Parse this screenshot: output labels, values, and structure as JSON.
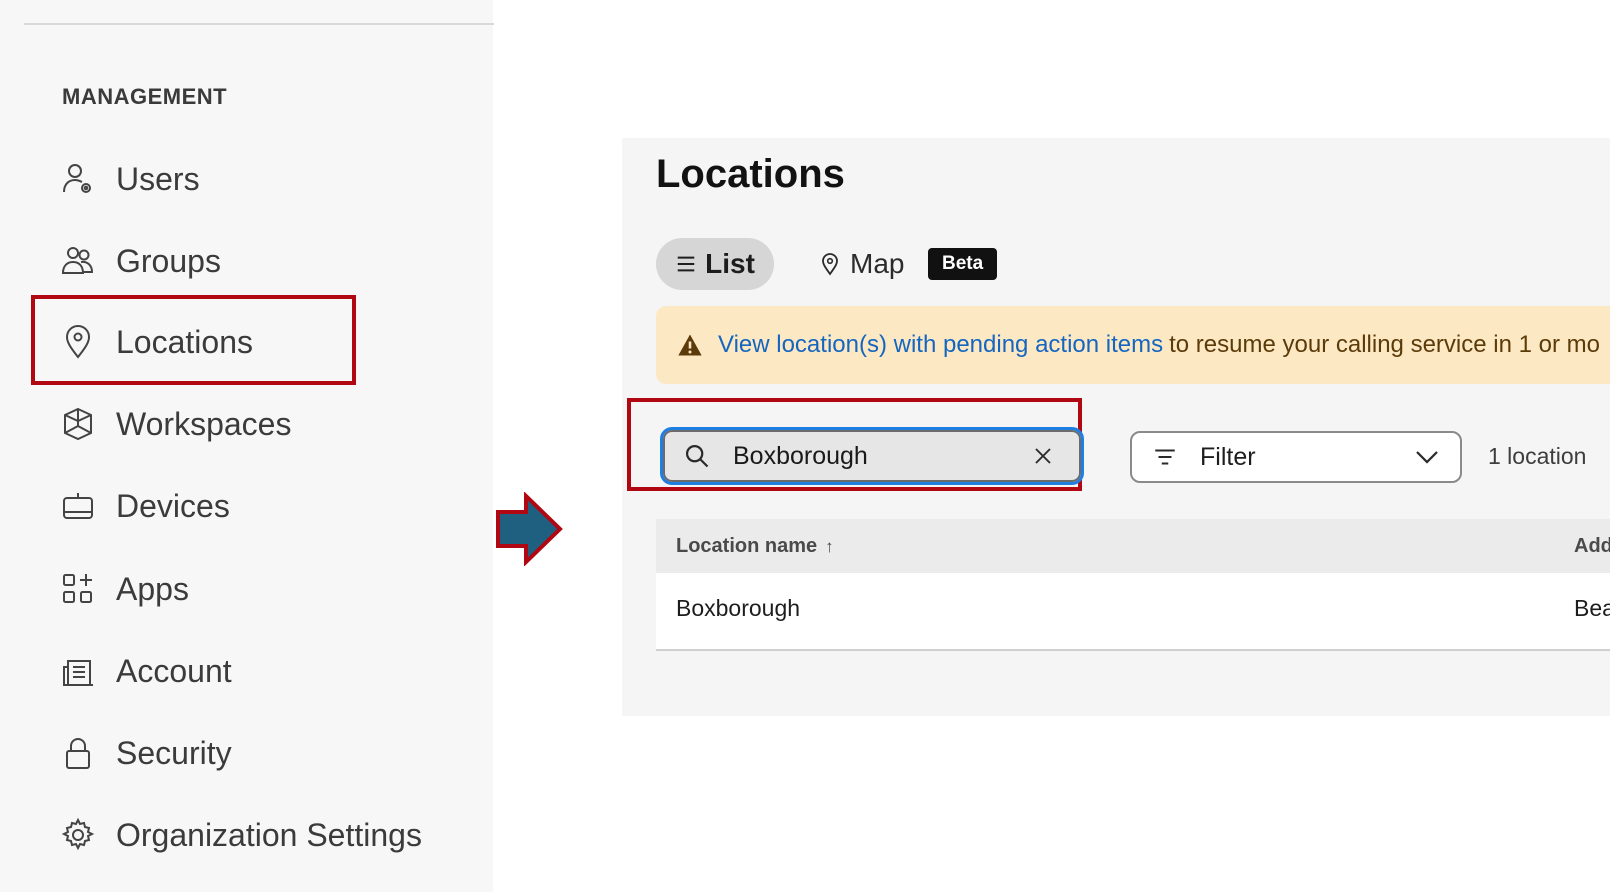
{
  "sidebar": {
    "section_heading": "MANAGEMENT",
    "items": [
      {
        "label": "Users",
        "icon": "users-icon"
      },
      {
        "label": "Groups",
        "icon": "groups-icon"
      },
      {
        "label": "Locations",
        "icon": "location-pin-icon",
        "highlighted": true
      },
      {
        "label": "Workspaces",
        "icon": "workspaces-icon"
      },
      {
        "label": "Devices",
        "icon": "devices-icon"
      },
      {
        "label": "Apps",
        "icon": "apps-icon"
      },
      {
        "label": "Account",
        "icon": "account-icon"
      },
      {
        "label": "Security",
        "icon": "lock-icon"
      },
      {
        "label": "Organization Settings",
        "icon": "gear-icon"
      }
    ]
  },
  "annotation": {
    "highlight_color": "#b00712",
    "arrow_fill": "#1f5f80",
    "arrow_outline": "#b00712"
  },
  "locations_page": {
    "title": "Locations",
    "view_tabs": {
      "list_label": "List",
      "map_label": "Map",
      "beta_badge": "Beta"
    },
    "banner": {
      "link_text": "View location(s) with pending action items",
      "text": "to resume your calling service in 1 or mo"
    },
    "search": {
      "value": "Boxborough",
      "placeholder": "Search"
    },
    "filter": {
      "label": "Filter"
    },
    "result_count": "1 location",
    "table": {
      "columns": [
        "Location name",
        "Add"
      ],
      "sort_indicator": "↑",
      "rows": [
        {
          "name": "Boxborough",
          "address": "Bea"
        }
      ]
    }
  }
}
